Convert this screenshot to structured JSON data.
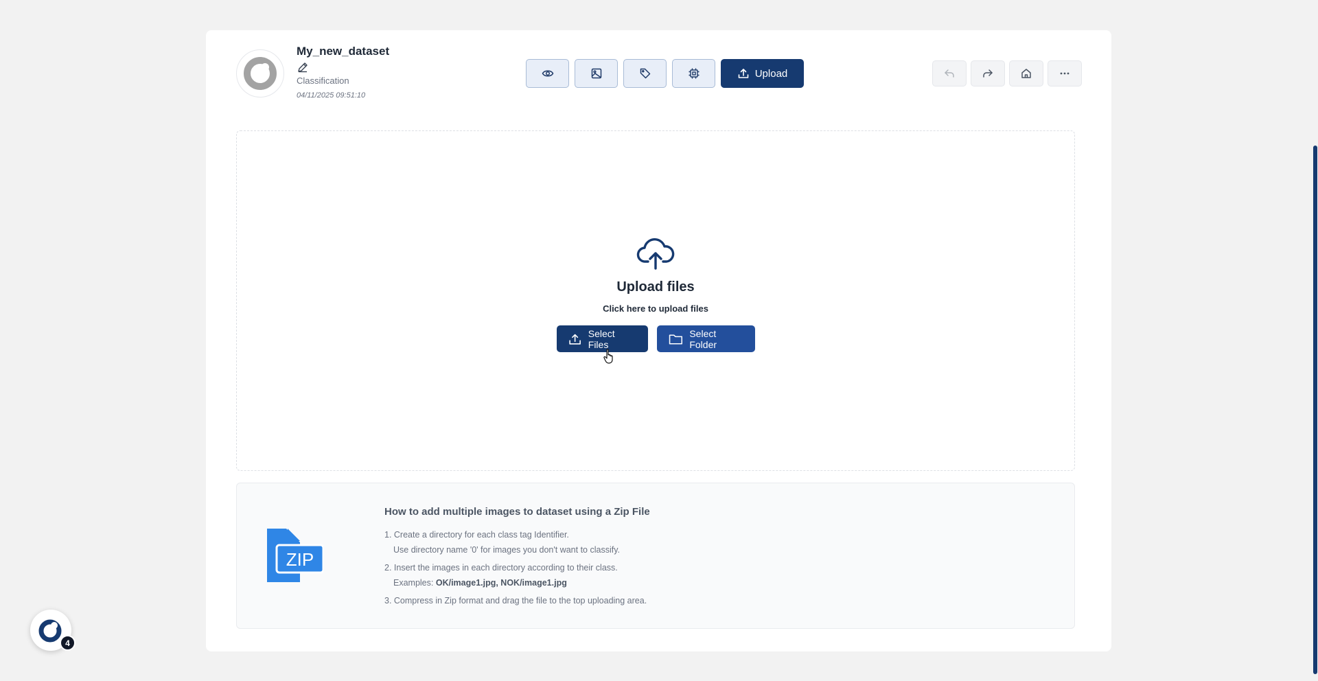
{
  "header": {
    "dataset_name": "My_new_dataset",
    "dataset_type": "Classification",
    "dataset_date": "04/11/2025 09:51:10",
    "toolbar": {
      "icons": [
        "eye-icon",
        "image-icon",
        "tag-icon",
        "chip-icon"
      ],
      "upload_label": "Upload"
    },
    "nav_icons": [
      "undo-icon",
      "redo-icon",
      "home-icon",
      "more-icon"
    ]
  },
  "dropzone": {
    "title": "Upload files",
    "subtitle": "Click here to upload files",
    "select_files_label": "Select Files",
    "select_folder_label": "Select Folder"
  },
  "info": {
    "title": "How to add multiple images to dataset using a Zip File",
    "zip_label": "ZIP",
    "step1": "1. Create a directory for each class tag Identifier.",
    "step1b": "Use directory name '0' for images you don't want to classify.",
    "step2": "2. Insert the images in each directory according to their class.",
    "step2b_prefix": "Examples: ",
    "step2b_examples": "OK/image1.jpg, NOK/image1.jpg",
    "step3": "3. Compress in Zip format and drag the file to the top uploading area."
  },
  "launcher": {
    "badge_count": "4"
  },
  "colors": {
    "primary": "#163a70",
    "secondary": "#234f9c",
    "zip_blue": "#2f86e6"
  }
}
